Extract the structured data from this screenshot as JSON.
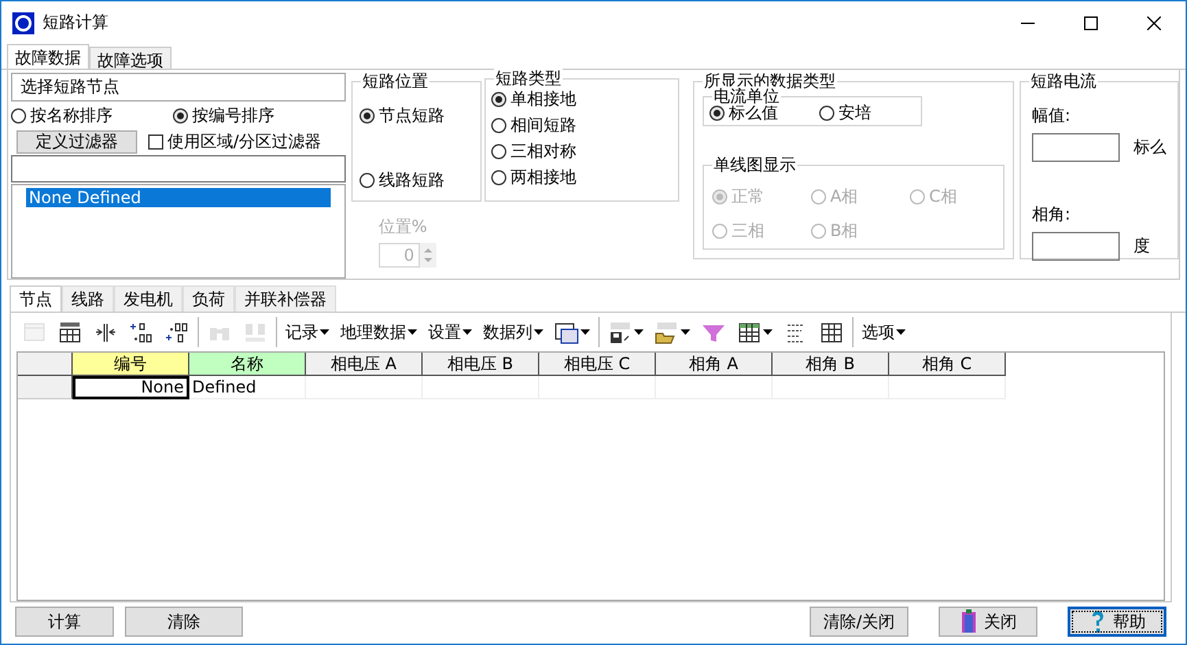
{
  "window": {
    "title": "短路计算"
  },
  "tabs": [
    {
      "label": "故障数据",
      "selected": true
    },
    {
      "label": "故障选项",
      "selected": false
    }
  ],
  "node_select": {
    "title": "选择短路节点",
    "sort_options": [
      {
        "label": "按名称排序",
        "selected": false
      },
      {
        "label": "按编号排序",
        "selected": true
      }
    ],
    "filter_button": "定义过滤器",
    "area_filter": {
      "label": "使用区域/分区过滤器",
      "checked": false
    },
    "list": [
      {
        "label": "None Defined",
        "selected": true
      }
    ]
  },
  "fault_location": {
    "title": "短路位置",
    "options": [
      {
        "label": "节点短路",
        "selected": true
      },
      {
        "label": "线路短路",
        "selected": false
      }
    ],
    "position": {
      "label": "位置%",
      "value": "0",
      "disabled": true
    }
  },
  "fault_type": {
    "title": "短路类型",
    "options": [
      {
        "label": "单相接地",
        "selected": true
      },
      {
        "label": "相间短路",
        "selected": false
      },
      {
        "label": "三相对称",
        "selected": false
      },
      {
        "label": "两相接地",
        "selected": false
      }
    ]
  },
  "display_data": {
    "title": "所显示的数据类型",
    "current_unit": {
      "title": "电流单位",
      "options": [
        {
          "label": "标么值",
          "selected": true
        },
        {
          "label": "安培",
          "selected": false
        }
      ]
    },
    "oneline": {
      "title": "单线图显示",
      "disabled": true,
      "options": [
        {
          "label": "正常",
          "selected": true
        },
        {
          "label": "A相",
          "selected": false
        },
        {
          "label": "C相",
          "selected": false
        },
        {
          "label": "三相",
          "selected": false
        },
        {
          "label": "B相",
          "selected": false
        }
      ]
    }
  },
  "fault_current": {
    "title": "短路电流",
    "magnitude": {
      "label": "幅值:",
      "unit": "标么"
    },
    "angle": {
      "label": "相角:",
      "unit": "度"
    }
  },
  "data_tabs": [
    {
      "label": "节点",
      "selected": true
    },
    {
      "label": "线路",
      "selected": false
    },
    {
      "label": "发电机",
      "selected": false
    },
    {
      "label": "负荷",
      "selected": false
    },
    {
      "label": "并联补偿器",
      "selected": false
    }
  ],
  "toolbar": [
    {
      "kind": "icon",
      "disabled": true,
      "dropdown": false
    },
    {
      "kind": "icon",
      "disabled": false,
      "dropdown": false
    },
    {
      "kind": "icon",
      "disabled": false,
      "dropdown": false
    },
    {
      "kind": "icon",
      "disabled": false,
      "dropdown": false
    },
    {
      "kind": "icon",
      "disabled": false,
      "dropdown": false
    },
    {
      "kind": "separator"
    },
    {
      "kind": "icon",
      "disabled": true,
      "dropdown": false
    },
    {
      "kind": "icon",
      "disabled": true,
      "dropdown": false
    },
    {
      "kind": "separator"
    },
    {
      "kind": "menu",
      "label": "记录"
    },
    {
      "kind": "menu",
      "label": "地理数据"
    },
    {
      "kind": "menu",
      "label": "设置"
    },
    {
      "kind": "menu",
      "label": "数据列"
    },
    {
      "kind": "icon",
      "disabled": false,
      "dropdown": true
    },
    {
      "kind": "separator"
    },
    {
      "kind": "icon",
      "disabled": false,
      "dropdown": true
    },
    {
      "kind": "icon",
      "disabled": false,
      "dropdown": true
    },
    {
      "kind": "icon",
      "disabled": false,
      "dropdown": false
    },
    {
      "kind": "icon",
      "disabled": false,
      "dropdown": true
    },
    {
      "kind": "icon",
      "disabled": false,
      "dropdown": false
    },
    {
      "kind": "icon",
      "disabled": false,
      "dropdown": false
    },
    {
      "kind": "separator"
    },
    {
      "kind": "menu",
      "label": "选项"
    }
  ],
  "table": {
    "columns": [
      {
        "label": "编号",
        "color": "#ffff99"
      },
      {
        "label": "名称",
        "color": "#c0ffc0"
      },
      {
        "label": "相电压 A",
        "color": "#f0f0f0"
      },
      {
        "label": "相电压 B",
        "color": "#f0f0f0"
      },
      {
        "label": "相电压 C",
        "color": "#f0f0f0"
      },
      {
        "label": "相角 A",
        "color": "#f0f0f0"
      },
      {
        "label": "相角 B",
        "color": "#f0f0f0"
      },
      {
        "label": "相角 C",
        "color": "#f0f0f0"
      }
    ],
    "rows": [
      {
        "cells": [
          {
            "text": "None",
            "selected": true
          },
          {
            "text": "Defined",
            "selected": false
          }
        ]
      }
    ]
  },
  "buttons": [
    {
      "label": "计算",
      "kind": "plain",
      "default": false
    },
    {
      "label": "清除",
      "kind": "plain",
      "default": false
    },
    {
      "label": "清除/关闭",
      "kind": "plain",
      "default": false
    },
    {
      "label": "关闭",
      "kind": "exit",
      "default": false
    },
    {
      "label": "帮助",
      "kind": "help",
      "default": true
    }
  ]
}
